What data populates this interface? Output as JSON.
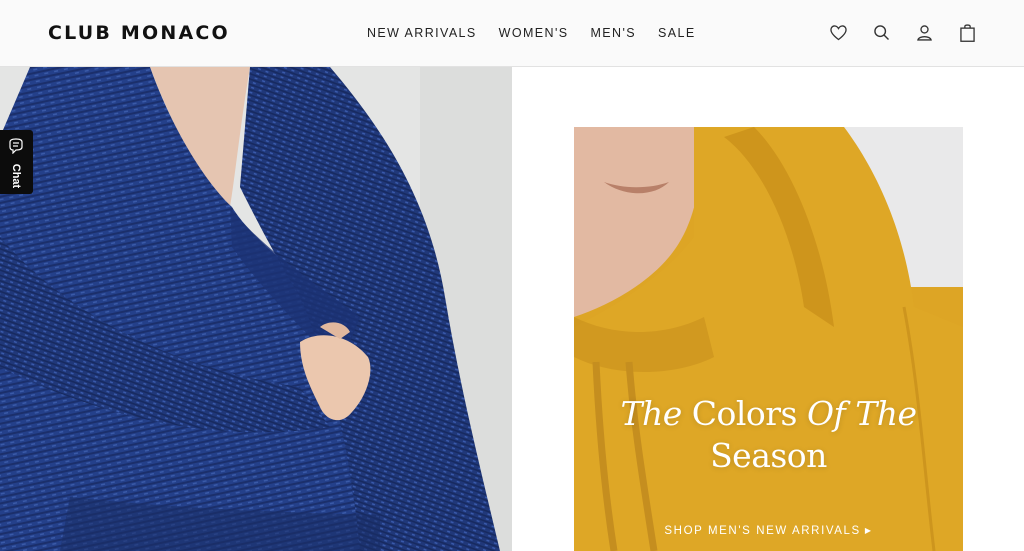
{
  "header": {
    "logo": "CLUB MONACO",
    "nav": [
      {
        "label": "NEW ARRIVALS"
      },
      {
        "label": "WOMEN'S"
      },
      {
        "label": "MEN'S"
      },
      {
        "label": "SALE"
      }
    ],
    "icons": [
      "heart-icon",
      "search-icon",
      "account-icon",
      "shopping-bag-icon"
    ]
  },
  "chat": {
    "label": "Chat"
  },
  "promo": {
    "title_italic_1": "The",
    "title_regular_1": "Colors",
    "title_italic_2": "Of",
    "title_italic_3": "The",
    "title_line_2": "Season",
    "cta": "SHOP MEN'S NEW ARRIVALS",
    "cta_arrow": "▶"
  },
  "colors": {
    "sweater_blue": "#24408a",
    "hoodie_yellow": "#dda525",
    "background": "#ffffff"
  }
}
